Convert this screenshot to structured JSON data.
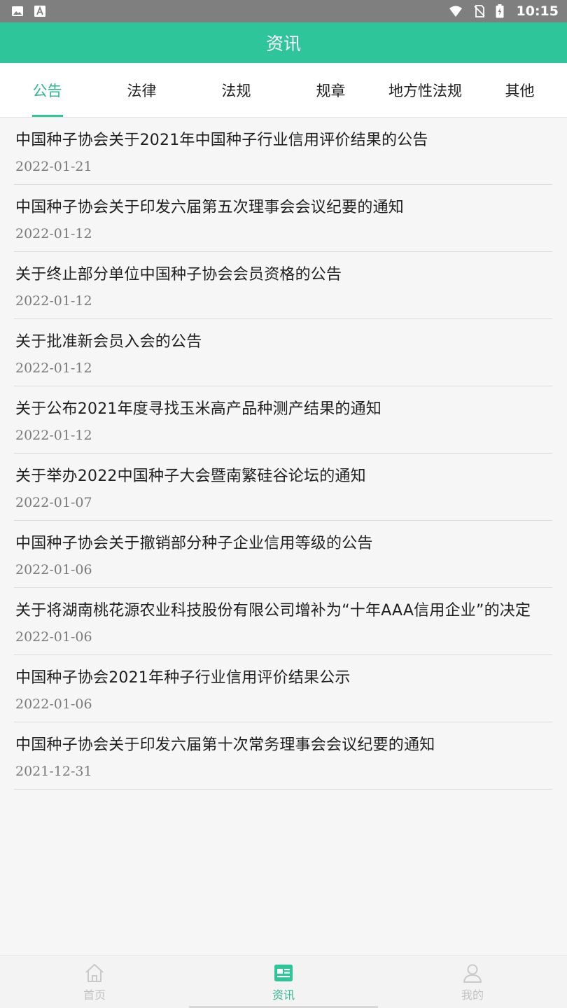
{
  "status_bar": {
    "time": "10:15",
    "icons": [
      "image-icon",
      "font-icon",
      "wifi-icon",
      "no-sim-icon",
      "battery-charging-icon"
    ]
  },
  "header": {
    "title": "资讯"
  },
  "tabs": [
    {
      "label": "公告",
      "active": true
    },
    {
      "label": "法律",
      "active": false
    },
    {
      "label": "法规",
      "active": false
    },
    {
      "label": "规章",
      "active": false
    },
    {
      "label": "地方性法规",
      "active": false
    },
    {
      "label": "其他",
      "active": false
    }
  ],
  "news": [
    {
      "title": "中国种子协会关于2021年中国种子行业信用评价结果的公告",
      "date": "2022-01-21"
    },
    {
      "title": "中国种子协会关于印发六届第五次理事会会议纪要的通知",
      "date": "2022-01-12"
    },
    {
      "title": "关于终止部分单位中国种子协会会员资格的公告",
      "date": "2022-01-12"
    },
    {
      "title": "关于批准新会员入会的公告",
      "date": "2022-01-12"
    },
    {
      "title": "关于公布2021年度寻找玉米高产品种测产结果的通知",
      "date": "2022-01-12"
    },
    {
      "title": "关于举办2022中国种子大会暨南繁硅谷论坛的通知",
      "date": "2022-01-07"
    },
    {
      "title": "中国种子协会关于撤销部分种子企业信用等级的公告",
      "date": "2022-01-06"
    },
    {
      "title": "关于将湖南桃花源农业科技股份有限公司增补为“十年AAA信用企业”的决定",
      "date": "2022-01-06"
    },
    {
      "title": "中国种子协会2021年种子行业信用评价结果公示",
      "date": "2022-01-06"
    },
    {
      "title": "中国种子协会关于印发六届第十次常务理事会会议纪要的通知",
      "date": "2021-12-31"
    }
  ],
  "bottom_nav": [
    {
      "label": "首页",
      "icon": "home-icon",
      "active": false
    },
    {
      "label": "资讯",
      "icon": "news-icon",
      "active": true
    },
    {
      "label": "我的",
      "icon": "profile-icon",
      "active": false
    }
  ],
  "colors": {
    "accent": "#2fc59a",
    "active_text": "#2fb592",
    "status_bar": "#7f7f7f",
    "inactive_nav": "#c2c2c2"
  }
}
